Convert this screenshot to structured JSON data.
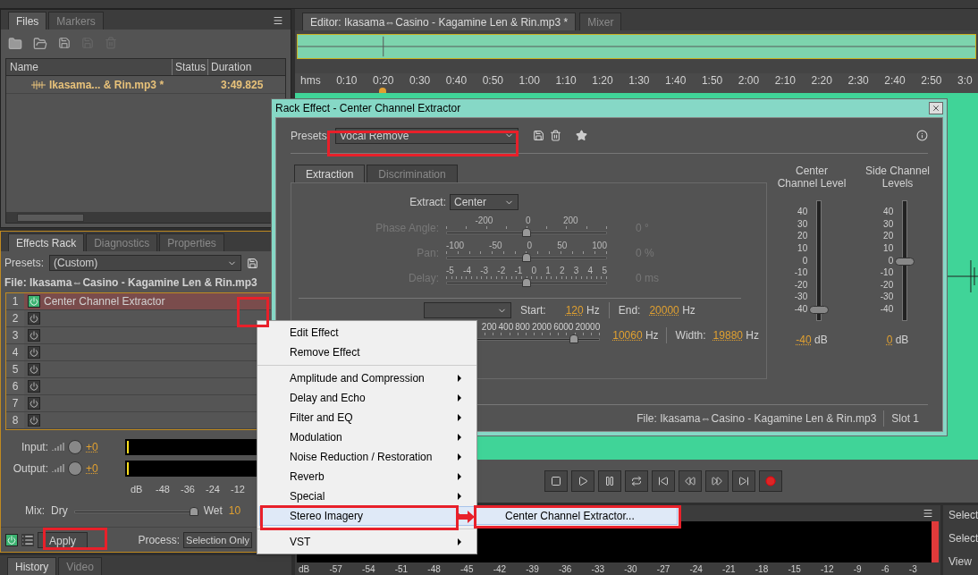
{
  "files_panel": {
    "tabs": [
      {
        "label": "Files",
        "selected": true
      },
      {
        "label": "Markers",
        "selected": false
      }
    ],
    "columns": [
      "Name",
      "Status",
      "Duration"
    ],
    "rows": [
      {
        "name": "Ikasama... & Rin.mp3 *",
        "duration": "3:49.825"
      }
    ]
  },
  "effects_rack": {
    "tabs": [
      {
        "label": "Effects Rack",
        "selected": true
      },
      {
        "label": "Diagnostics",
        "selected": false
      },
      {
        "label": "Properties",
        "selected": false
      }
    ],
    "presets_label": "Presets:",
    "preset": "(Custom)",
    "file": "File: Ikasama⇔Casino - Kagamine Len & Rin.mp3",
    "slots": [
      {
        "number": "1",
        "name": "Center Channel Extractor",
        "on": true,
        "selected": true
      },
      {
        "number": "2",
        "on": false,
        "selected": false
      },
      {
        "number": "3",
        "on": false,
        "selected": false
      },
      {
        "number": "4",
        "on": false,
        "selected": false
      },
      {
        "number": "5",
        "on": false,
        "selected": false
      },
      {
        "number": "6",
        "on": false,
        "selected": false
      },
      {
        "number": "7",
        "on": false,
        "selected": false
      },
      {
        "number": "8",
        "on": false,
        "selected": false
      }
    ],
    "io": [
      {
        "label": "Input:",
        "value": "+0"
      },
      {
        "label": "Output:",
        "value": "+0"
      }
    ],
    "meter_scale": [
      "dB",
      "-48",
      "-36",
      "-24",
      "-12"
    ],
    "mix": {
      "label": "Mix:",
      "dry": "Dry",
      "wet": "Wet",
      "value": "10",
      "level": 0.97
    },
    "power_on": true,
    "apply": "Apply",
    "process_label": "Process:",
    "process": "Selection Only"
  },
  "bottom_tabs": [
    {
      "label": "History",
      "selected": true
    },
    {
      "label": "Video",
      "selected": false
    }
  ],
  "editor": {
    "tabs": [
      {
        "label": "Editor: Ikasama⇔Casino - Kagamine Len & Rin.mp3 *",
        "selected": true
      },
      {
        "label": "Mixer",
        "selected": false
      }
    ],
    "ruler": [
      "hms",
      "0:10",
      "0:20",
      "0:30",
      "0:40",
      "0:50",
      "1:00",
      "1:10",
      "1:20",
      "1:30",
      "1:40",
      "1:50",
      "2:00",
      "2:10",
      "2:20",
      "2:30",
      "2:40",
      "2:50",
      "3:0"
    ],
    "level_scale": [
      "dB",
      "-57",
      "-54",
      "-51",
      "-48",
      "-45",
      "-42",
      "-39",
      "-36",
      "-33",
      "-30",
      "-27",
      "-24",
      "-21",
      "-18",
      "-15",
      "-12",
      "-9",
      "-6",
      "-3"
    ],
    "side_panel": [
      "Select",
      "Select",
      "View"
    ]
  },
  "dialog": {
    "title": "Rack Effect - Center Channel Extractor",
    "presets_label": "Presets:",
    "preset": "Vocal Remove",
    "tabs": [
      {
        "label": "Extraction",
        "selected": true
      },
      {
        "label": "Discrimination",
        "selected": false
      }
    ],
    "extract_label": "Extract:",
    "extract": "Center",
    "sliders": [
      {
        "label": "Phase Angle:",
        "ticks": [
          "-200",
          "0",
          "200"
        ],
        "value": "0",
        "unit": "°",
        "level": 0.5,
        "disabled": true
      },
      {
        "label": "Pan:",
        "ticks": [
          "-100",
          "-50",
          "0",
          "50",
          "100"
        ],
        "value": "0",
        "unit": "%",
        "level": 0.5,
        "disabled": true
      },
      {
        "label": "Delay:",
        "ticks": [
          "-5",
          "-4",
          "-3",
          "-2",
          "-1",
          "0",
          "1",
          "2",
          "3",
          "4",
          "5"
        ],
        "value": "0",
        "unit": "ms",
        "level": 0.5,
        "disabled": true
      }
    ],
    "start": {
      "label": "Start:",
      "value": "120",
      "unit": "Hz"
    },
    "end": {
      "label": "End:",
      "value": "20000",
      "unit": "Hz"
    },
    "freq_ticks": [
      "200",
      "400",
      "800",
      "2000",
      "6000",
      "20000"
    ],
    "freq_slider": {
      "level": 0.86
    },
    "center_freq": {
      "value": "10060",
      "unit": "Hz"
    },
    "width": {
      "label": "Width:",
      "value": "19880",
      "unit": "Hz"
    },
    "meters": [
      {
        "title": "Center Channel Level",
        "scale": [
          "40",
          "30",
          "20",
          "10",
          "0",
          "-10",
          "-20",
          "-30",
          "-40"
        ],
        "level": 0.1,
        "value": "-40",
        "unit": "dB"
      },
      {
        "title": "Side Channel Levels",
        "scale": [
          "40",
          "30",
          "20",
          "10",
          "0",
          "-10",
          "-20",
          "-30",
          "-40"
        ],
        "level": 0.5,
        "value": "0",
        "unit": "dB"
      }
    ],
    "footer_file": "File: Ikasama⇔Casino - Kagamine Len & Rin.mp3",
    "slot": "Slot 1"
  },
  "context_menu": {
    "groups": [
      [
        {
          "label": "Edit Effect",
          "kind": "action",
          "highlighted": false
        },
        {
          "label": "Remove Effect",
          "kind": "action",
          "highlighted": false
        }
      ],
      [
        {
          "label": "Amplitude and Compression",
          "kind": "submenu",
          "highlighted": false
        },
        {
          "label": "Delay and Echo",
          "kind": "submenu",
          "highlighted": false
        },
        {
          "label": "Filter and EQ",
          "kind": "submenu",
          "highlighted": false
        },
        {
          "label": "Modulation",
          "kind": "submenu",
          "highlighted": false
        },
        {
          "label": "Noise Reduction / Restoration",
          "kind": "submenu",
          "highlighted": false
        },
        {
          "label": "Reverb",
          "kind": "submenu",
          "highlighted": false
        },
        {
          "label": "Special",
          "kind": "submenu",
          "highlighted": false
        },
        {
          "label": "Stereo Imagery",
          "kind": "submenu",
          "highlighted": true
        }
      ],
      [
        {
          "label": "VST",
          "kind": "submenu",
          "highlighted": false
        }
      ]
    ],
    "submenu": [
      {
        "label": "Center Channel Extractor...",
        "highlighted": true
      }
    ]
  }
}
